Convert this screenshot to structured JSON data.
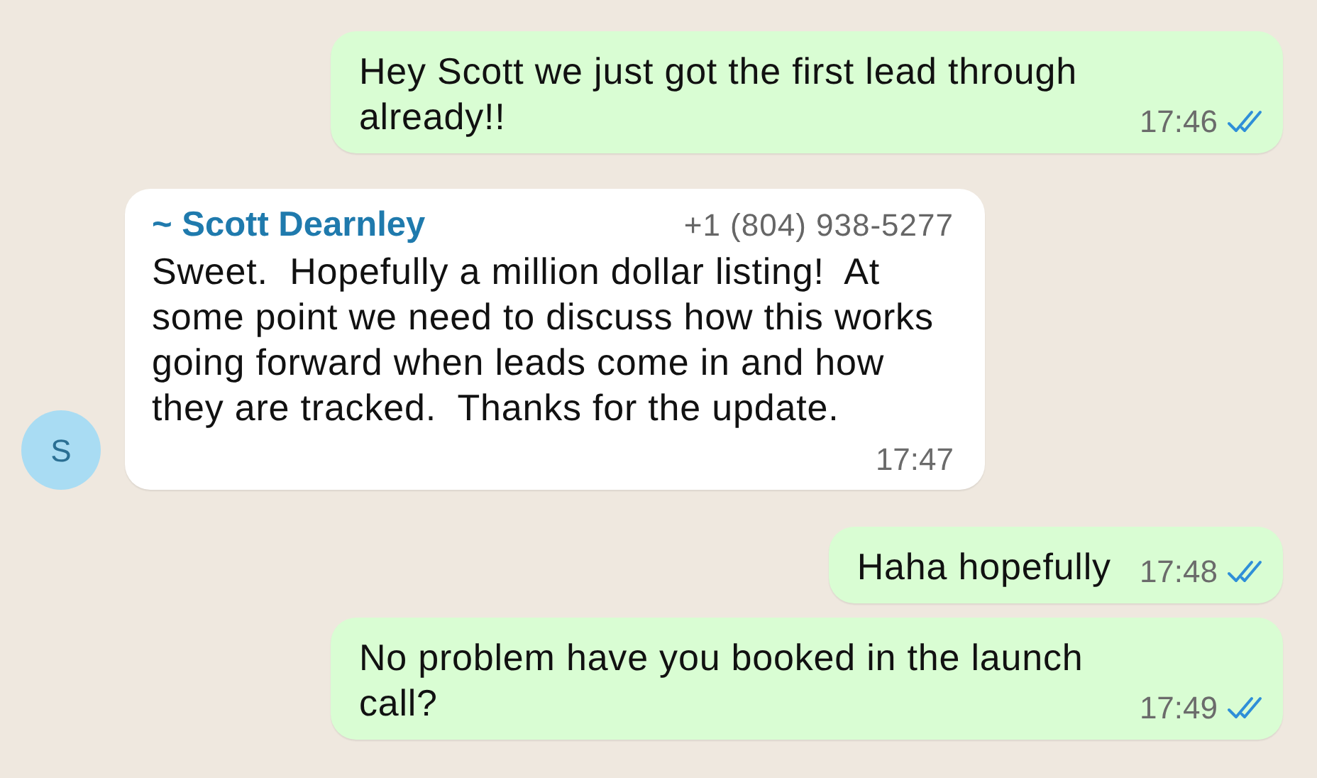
{
  "messages": [
    {
      "kind": "outgoing",
      "text": "Hey Scott we just got the first lead through already!!",
      "time": "17:46",
      "read": true
    },
    {
      "kind": "incoming",
      "sender": "~ Scott Dearnley",
      "phone": "+1 (804) 938-5277",
      "avatar": "S",
      "text": "Sweet.  Hopefully a million dollar listing!  At some point we need to discuss how this works going forward when leads come in and how they are tracked.  Thanks for the update.",
      "time": "17:47"
    },
    {
      "kind": "outgoing",
      "text": "Haha hopefully",
      "time": "17:48",
      "read": true
    },
    {
      "kind": "outgoing",
      "text": "No problem have you booked in the launch call?",
      "time": "17:49",
      "read": true
    }
  ]
}
